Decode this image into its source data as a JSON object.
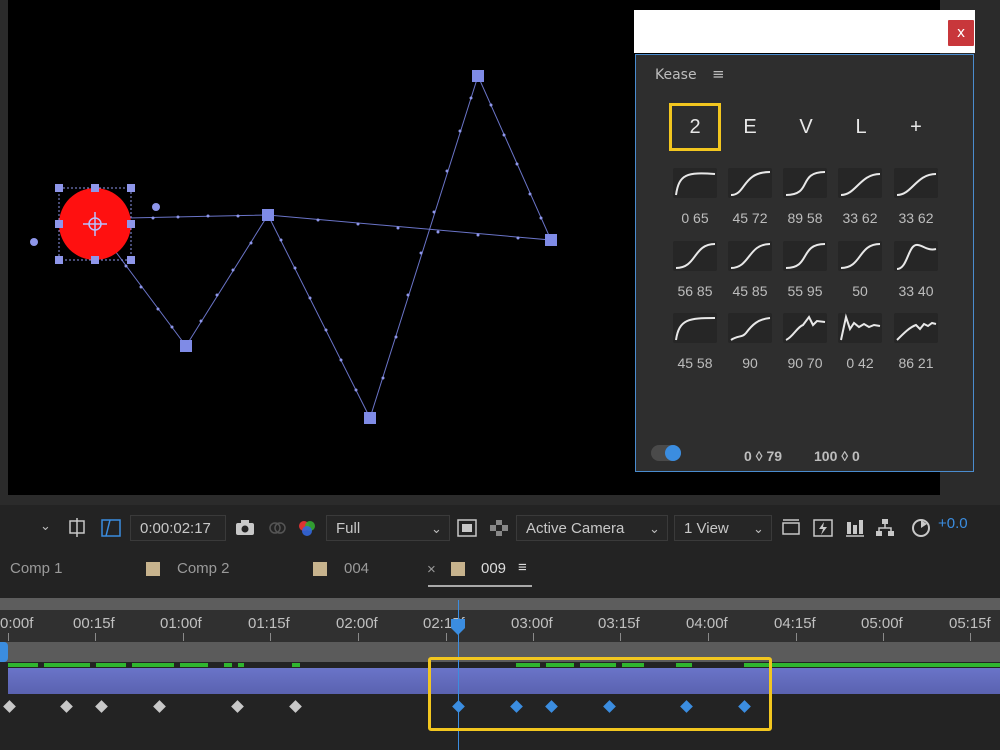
{
  "kease": {
    "title": "Kease",
    "close_label": "x",
    "modes": [
      "2",
      "E",
      "V",
      "L",
      "+"
    ],
    "selected_mode": "2",
    "presets": [
      {
        "label": "0 65"
      },
      {
        "label": "45 72"
      },
      {
        "label": "89 58"
      },
      {
        "label": "33 62"
      },
      {
        "label": "33 62"
      },
      {
        "label": "56 85"
      },
      {
        "label": "45 85"
      },
      {
        "label": "55 95"
      },
      {
        "label": "50"
      },
      {
        "label": "33 40"
      },
      {
        "label": "45 58"
      },
      {
        "label": "90"
      },
      {
        "label": "90 70"
      },
      {
        "label": "0 42"
      },
      {
        "label": "86 21"
      }
    ],
    "footer_in": "0 ◊ 79",
    "footer_out": "100 ◊ 0",
    "toggle_on": true,
    "accent": "#3b8de0",
    "highlight": "#f2c61f"
  },
  "toolbar": {
    "timecode": "0:00:02:17",
    "resolution": "Full",
    "camera": "Active Camera",
    "views": "1 View",
    "exposure": "+0.0"
  },
  "tabs": [
    {
      "label": "Comp 1",
      "active": false
    },
    {
      "label": "Comp 2",
      "active": false
    },
    {
      "label": "004",
      "active": false
    },
    {
      "label": "009",
      "active": true
    }
  ],
  "tab_close": "×",
  "tab_menu": "≡",
  "timeline": {
    "ruler_labels": [
      "0:00f",
      "00:15f",
      "01:00f",
      "01:15f",
      "02:00f",
      "02:15f",
      "03:00f",
      "03:15f",
      "04:00f",
      "04:15f",
      "05:00f",
      "05:15f"
    ],
    "current_time": "0:00:02:17",
    "layer_color": "#6a74c8"
  }
}
